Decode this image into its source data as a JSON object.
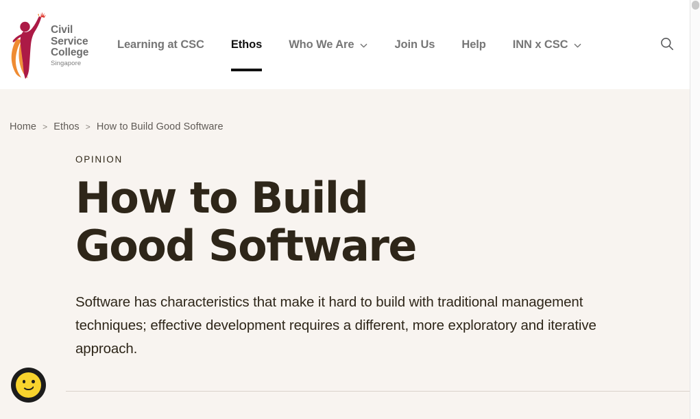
{
  "header": {
    "logo": {
      "mark_name": "csc-figure-logo",
      "line1": "Civil",
      "line2": "Service",
      "line3": "College",
      "sub": "Singapore",
      "figure_color": "#ac1a46",
      "swoosh_color": "#ef8b32"
    },
    "nav": [
      {
        "label": "Learning at CSC",
        "active": false,
        "has_chevron": false
      },
      {
        "label": "Ethos",
        "active": true,
        "has_chevron": false
      },
      {
        "label": "Who We Are",
        "active": false,
        "has_chevron": true
      },
      {
        "label": "Join Us",
        "active": false,
        "has_chevron": false
      },
      {
        "label": "Help",
        "active": false,
        "has_chevron": false
      },
      {
        "label": "INN x CSC",
        "active": false,
        "has_chevron": true
      }
    ],
    "search_icon": "search-icon"
  },
  "breadcrumb": {
    "separator": ">",
    "items": [
      {
        "label": "Home"
      },
      {
        "label": "Ethos"
      },
      {
        "label": "How to Build Good Software"
      }
    ]
  },
  "article": {
    "kicker": "OPINION",
    "title": "How to Build Good Software",
    "standfirst": "Software has characteristics that make it hard to build with traditional management techniques; effective development requires a different, more exploratory and iterative approach."
  },
  "feedback": {
    "icon": "smiley-face-icon",
    "face_color": "#f8d32d",
    "ring_color": "#1c1c1c"
  },
  "theme": {
    "page_background": "#f8f4f0",
    "header_background": "#ffffff",
    "title_color": "#2e2619",
    "nav_inactive_color": "#767676",
    "nav_active_color": "#111111",
    "divider_color": "#d9d2cb"
  }
}
